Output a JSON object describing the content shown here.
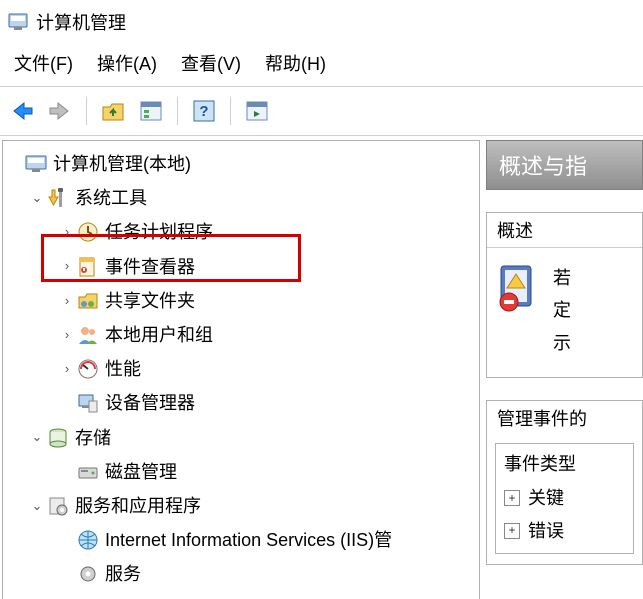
{
  "title": "计算机管理",
  "menus": {
    "file": "文件(F)",
    "action": "操作(A)",
    "view": "查看(V)",
    "help": "帮助(H)"
  },
  "toolbar": {
    "back": "back",
    "forward": "forward",
    "up_folder": "up-folder",
    "properties": "properties",
    "help": "help",
    "refresh_pane": "refresh-pane"
  },
  "tree": {
    "root": "计算机管理(本地)",
    "system_tools": "系统工具",
    "task_scheduler": "任务计划程序",
    "event_viewer": "事件查看器",
    "shared_folders": "共享文件夹",
    "local_users": "本地用户和组",
    "performance": "性能",
    "device_manager": "设备管理器",
    "storage": "存储",
    "disk_management": "磁盘管理",
    "services_apps": "服务和应用程序",
    "iis": "Internet Information Services (IIS)管",
    "services": "服务"
  },
  "right": {
    "header": "概述与指",
    "overview_title": "概述",
    "overview_lines": {
      "l1": "若",
      "l2": "定",
      "l3": "示"
    },
    "manage_title": "管理事件的",
    "event_types_title": "事件类型",
    "critical": "关键",
    "error": "错误"
  }
}
